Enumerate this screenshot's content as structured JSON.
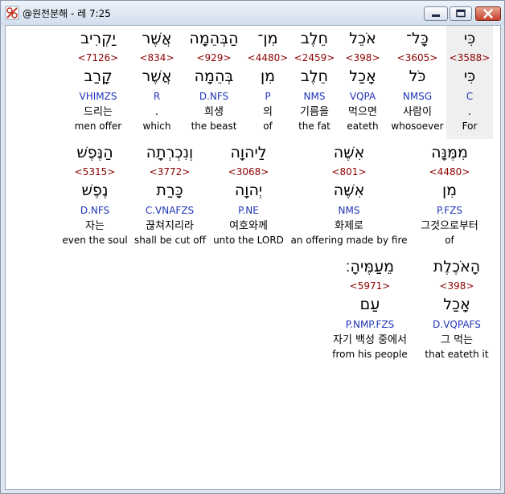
{
  "window": {
    "title": "@원전분해 - 레 7:25"
  },
  "titlebar_icons": [
    "minimize-icon",
    "maximize-icon",
    "close-icon"
  ],
  "rows": [
    {
      "words": [
        {
          "hebrew": "כִּי",
          "strong": "<3588>",
          "lemma": "כִּי",
          "morph": "C",
          "korean": ".",
          "english": "For"
        },
        {
          "hebrew": "כָּל־",
          "strong": "<3605>",
          "lemma": "כֹּל",
          "morph": "NMSG",
          "korean": "사람이",
          "english": "whosoever"
        },
        {
          "hebrew": "אֹכֵל",
          "strong": "<398>",
          "lemma": "אָכַל",
          "morph": "VQPA",
          "korean": "먹으면",
          "english": "eateth"
        },
        {
          "hebrew": "חֵלֶב",
          "strong": "<2459>",
          "lemma": "חֵלֶב",
          "morph": "NMS",
          "korean": "기름을",
          "english": "the fat"
        },
        {
          "hebrew": "מִן־",
          "strong": "<4480>",
          "lemma": "מִן",
          "morph": "P",
          "korean": "의",
          "english": "of"
        },
        {
          "hebrew": "הַבְּהֵמָה",
          "strong": "<929>",
          "lemma": "בְּהֵמָה",
          "morph": "D.NFS",
          "korean": "희생",
          "english": "the beast"
        },
        {
          "hebrew": "אֲשֶׁר",
          "strong": "<834>",
          "lemma": "אֲשֶׁר",
          "morph": "R",
          "korean": ".",
          "english": "which"
        },
        {
          "hebrew": "יַקְרִיב",
          "strong": "<7126>",
          "lemma": "קָרַב",
          "morph": "VHIMZS",
          "korean": "드리는",
          "english": "men offer"
        }
      ]
    },
    {
      "words": [
        {
          "hebrew": "מִמֶּנָּה",
          "strong": "<4480>",
          "lemma": "מִן",
          "morph": "P.FZS",
          "korean": "그것으로부터",
          "english": "of"
        },
        {
          "hebrew": "אִשֶּׁה",
          "strong": "<801>",
          "lemma": "אִשֶּׁה",
          "morph": "NMS",
          "korean": "화제로",
          "english": "an offering made by fire"
        },
        {
          "hebrew": "לַיהוָה",
          "strong": "<3068>",
          "lemma": "יְהוָה",
          "morph": "P.NE",
          "korean": "여호와께",
          "english": "unto the LORD"
        },
        {
          "hebrew": "וְנִכְרְתָה",
          "strong": "<3772>",
          "lemma": "כָּרַת",
          "morph": "C.VNAFZS",
          "korean": "끊쳐지리라",
          "english": "shall be cut off"
        },
        {
          "hebrew": "הַנֶּפֶשׁ",
          "strong": "<5315>",
          "lemma": "נֶפֶשׁ",
          "morph": "D.NFS",
          "korean": "자는",
          "english": "even the soul"
        }
      ]
    },
    {
      "words": [
        {
          "hebrew": "הָאֹכֶלֶת",
          "strong": "<398>",
          "lemma": "אָכַל",
          "morph": "D.VQPAFS",
          "korean": "그 먹는",
          "english": "that eateth it"
        },
        {
          "hebrew": "מֵעַמֶּיהָ׃",
          "strong": "<5971>",
          "lemma": "עַם",
          "morph": "P.NMP.FZS",
          "korean": "자기 백성 중에서",
          "english": "from his people"
        }
      ]
    }
  ]
}
